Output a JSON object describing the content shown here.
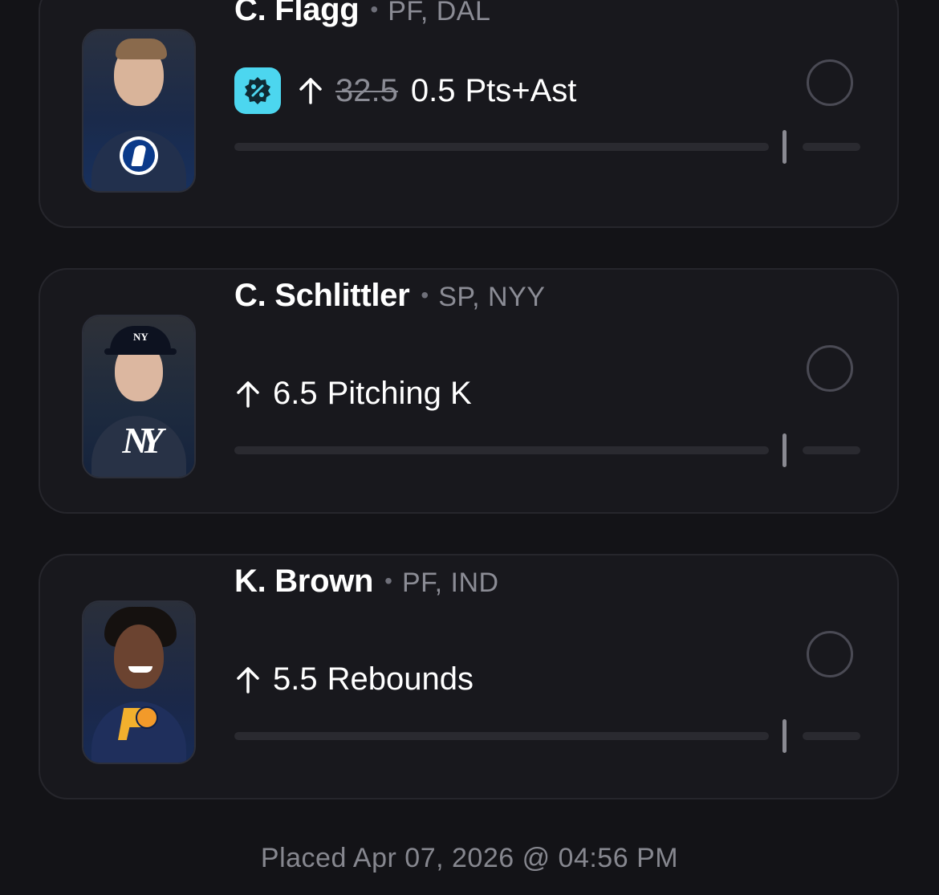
{
  "picks": [
    {
      "player": "C. Flagg",
      "position_team": "PF, DAL",
      "direction": "up-arrow-icon",
      "promo": true,
      "promo_icon": "percent-badge-icon",
      "original_line": "32.5",
      "line": "0.5",
      "stat": "Pts+Ast",
      "team_color": "#1e3a6e",
      "team_logo": "mavericks-logo"
    },
    {
      "player": "C. Schlittler",
      "position_team": "SP, NYY",
      "direction": "up-arrow-icon",
      "promo": false,
      "line": "6.5",
      "stat": "Pitching K",
      "team_color": "#1a2740",
      "team_logo": "yankees-logo"
    },
    {
      "player": "K. Brown",
      "position_team": "PF, IND",
      "direction": "up-arrow-icon",
      "promo": false,
      "line": "5.5",
      "stat": "Rebounds",
      "team_color": "#1b2a52",
      "team_logo": "pacers-logo"
    }
  ],
  "footer": {
    "placed": "Placed Apr 07, 2026 @ 04:56 PM"
  },
  "colors": {
    "background": "#131317",
    "card": "#18181d",
    "promo": "#4cd6ef",
    "muted_text": "#8b8c95"
  }
}
